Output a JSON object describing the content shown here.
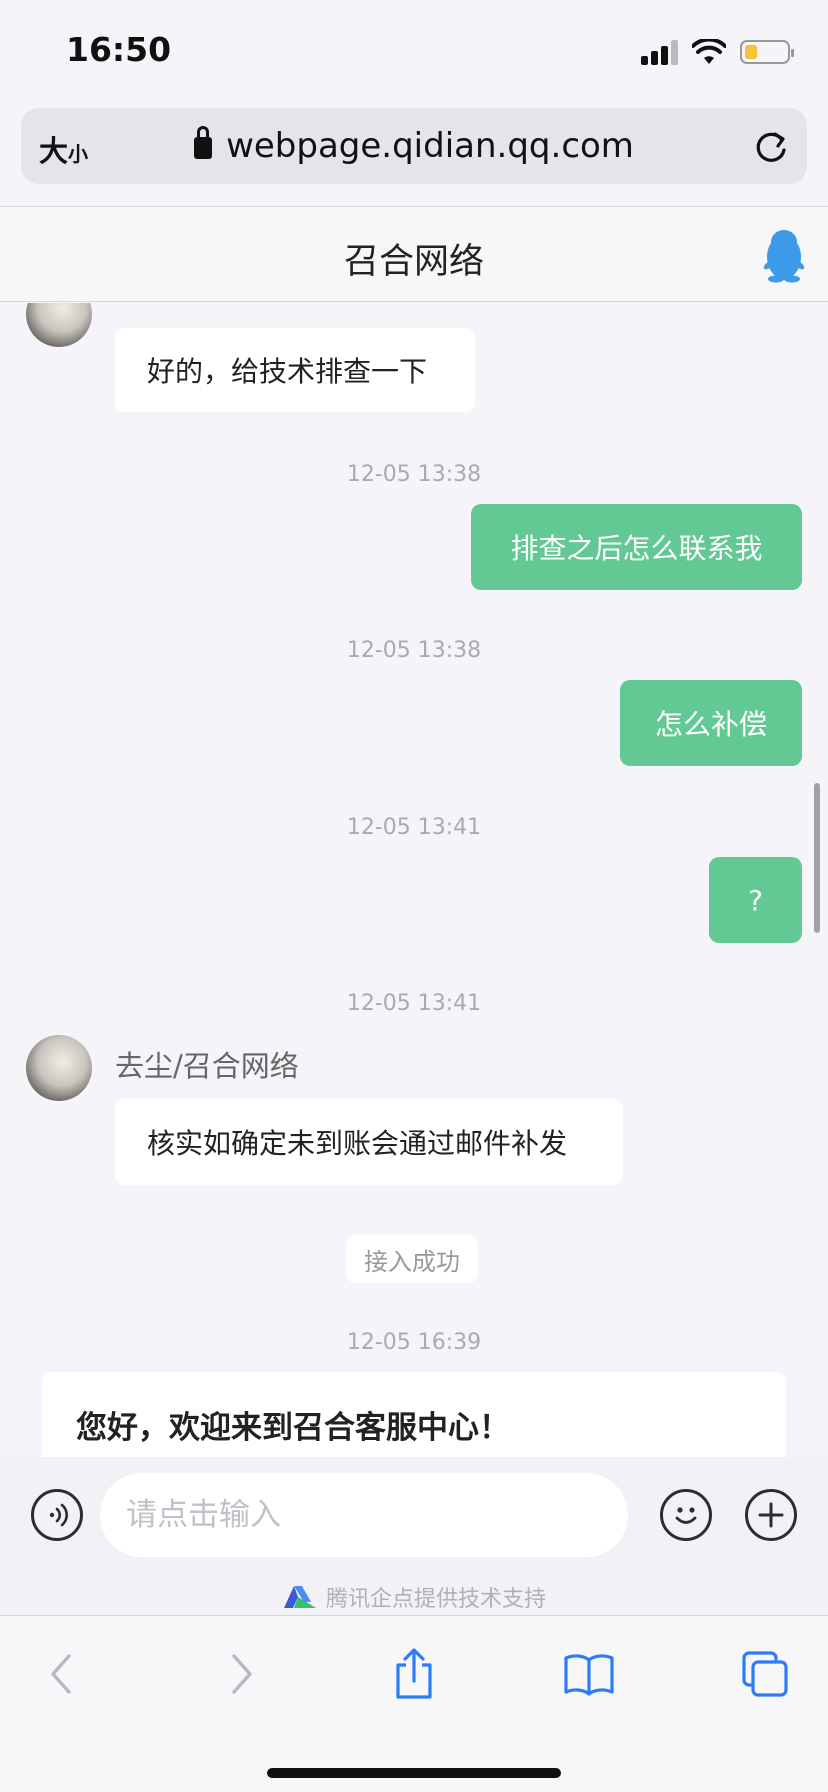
{
  "status_bar": {
    "time": "16:50",
    "battery_level": 0.3
  },
  "address_bar": {
    "text_size_big": "大",
    "text_size_small": "小",
    "url": "webpage.qidian.qq.com"
  },
  "chat": {
    "title": "召合网络"
  },
  "messages": {
    "m1": {
      "text": "好的，给技术排查一下"
    },
    "t1": "12-05 13:38",
    "m2": {
      "text": "排查之后怎么联系我"
    },
    "t2": "12-05 13:38",
    "m3": {
      "text": "怎么补偿"
    },
    "t3": "12-05 13:41",
    "m4": {
      "text": "?"
    },
    "t4": "12-05 13:41",
    "m5": {
      "sender": "去尘/召合网络",
      "text": "核实如确定未到账会通过邮件补发"
    },
    "system": "接入成功",
    "t5": "12-05 16:39",
    "welcome": "您好，欢迎来到召合客服中心！"
  },
  "input": {
    "placeholder": "请点击输入",
    "powered_by": "腾讯企点提供技术支持"
  },
  "colors": {
    "accent_green": "#62c994",
    "qq_blue": "#3c9be8"
  },
  "icons": {
    "voice": "voice-icon",
    "emoji": "emoji-icon",
    "plus": "plus-icon",
    "back": "back-icon",
    "forward": "forward-icon",
    "share": "share-icon",
    "bookmarks": "bookmarks-icon",
    "tabs": "tabs-icon",
    "qq": "qq-penguin-icon",
    "lock": "lock-icon",
    "reload": "reload-icon"
  }
}
